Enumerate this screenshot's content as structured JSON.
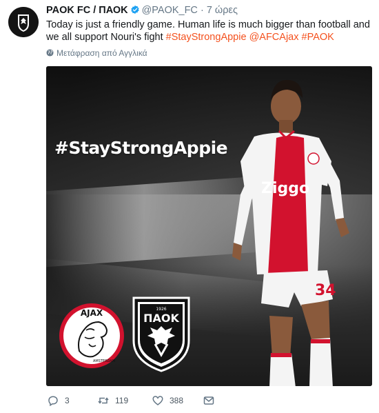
{
  "tweet": {
    "display_name": "PAOK FC / ΠΑΟΚ",
    "handle": "@PAOK_FC",
    "separator": "·",
    "time": "7 ώρες",
    "text_plain_1": "Today is just a friendly game. Human life is much bigger than football and we all support Nouri's fight",
    "hashtag_1": "#StayStrongAppie",
    "mention_1": "@AFCAjax",
    "hashtag_2": "#PAOK",
    "translate_label": "Μετάφραση από Αγγλικά",
    "link_color": "#f4511e"
  },
  "media": {
    "overlay_text": "#StayStrongAppie",
    "shirt_sponsor": "Ziggo",
    "shirt_number": "34",
    "ajax_logo_text_top": "AJAX",
    "ajax_logo_text_bottom": "AMSTERDAM",
    "paok_logo_year": "1926",
    "paok_logo_name": "ΠΑΟΚ"
  },
  "actions": {
    "reply_count": "3",
    "retweet_count": "119",
    "like_count": "388"
  },
  "icons": [
    "avatar-paok-crest",
    "verified-badge-icon",
    "globe-icon",
    "reply-icon",
    "retweet-icon",
    "like-icon",
    "direct-message-icon"
  ]
}
